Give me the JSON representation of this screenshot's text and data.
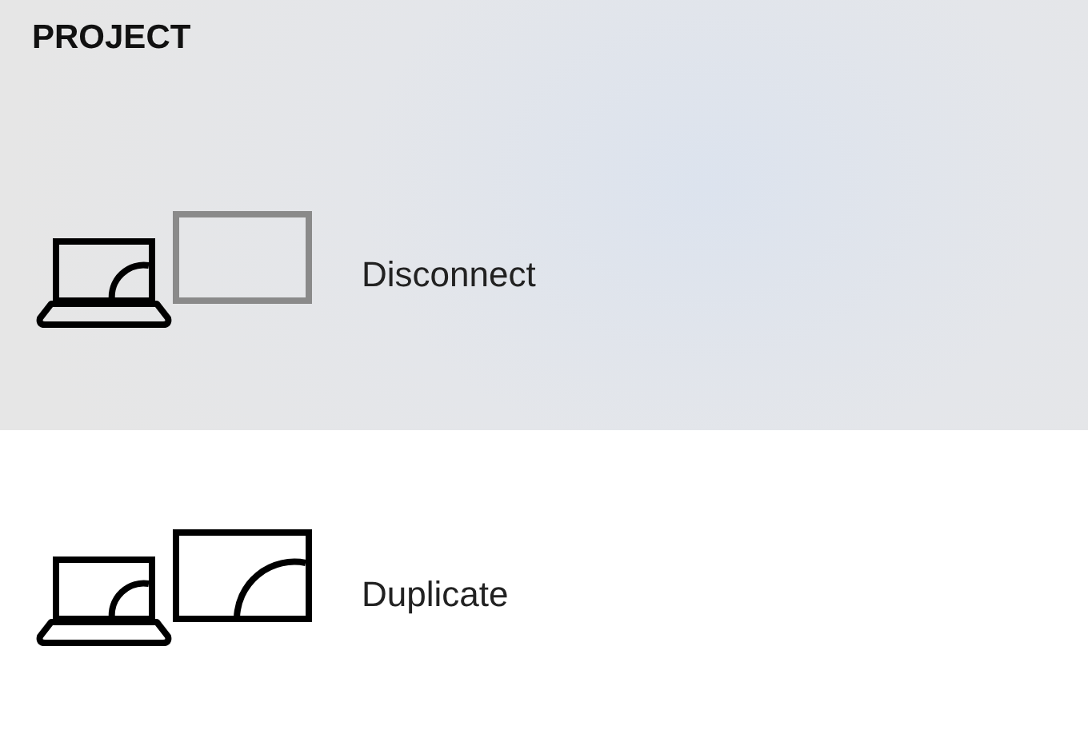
{
  "header": "PROJECT",
  "options": [
    {
      "label": "Disconnect",
      "kind": "disconnect",
      "selected": false
    },
    {
      "label": "Duplicate",
      "kind": "duplicate",
      "selected": true
    }
  ]
}
